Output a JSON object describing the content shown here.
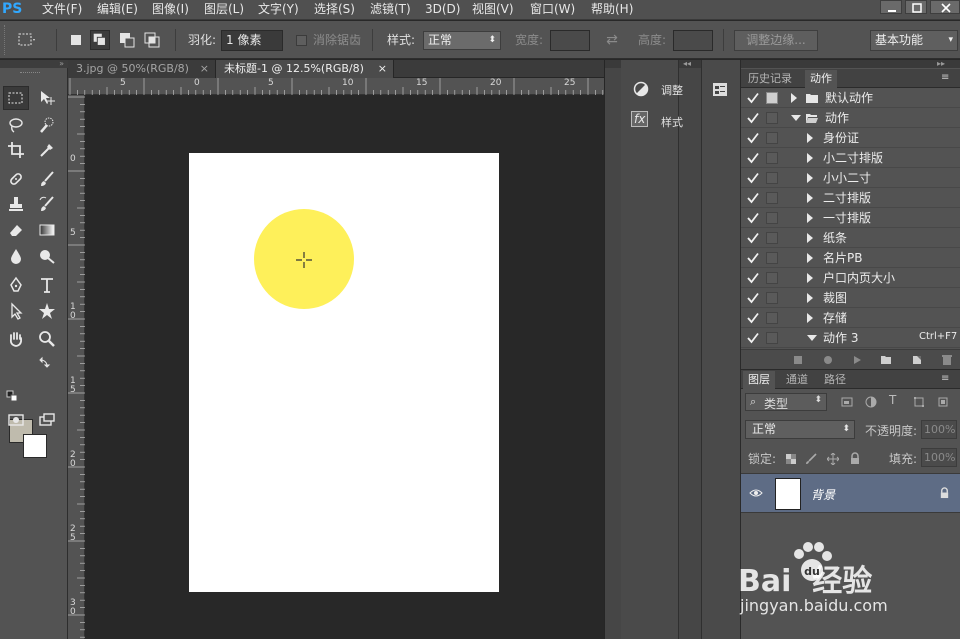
{
  "app": {
    "logo": "PS"
  },
  "menu": [
    "文件(F)",
    "编辑(E)",
    "图像(I)",
    "图层(L)",
    "文字(Y)",
    "选择(S)",
    "滤镜(T)",
    "3D(D)",
    "视图(V)",
    "窗口(W)",
    "帮助(H)"
  ],
  "options": {
    "feather_label": "羽化:",
    "feather_value": "1 像素",
    "antialias_label": "消除锯齿",
    "style_label": "样式:",
    "style_value": "正常",
    "width_label": "宽度:",
    "height_label": "高度:",
    "refine_edge": "调整边缘...",
    "workspace": "基本功能"
  },
  "tabs": [
    {
      "label": "3.jpg @ 50%(RGB/8)",
      "close": "×"
    },
    {
      "label": "未标题-1 @ 12.5%(RGB/8)",
      "close": "×"
    }
  ],
  "ruler": {
    "top_ticks": [
      "5",
      "0",
      "5",
      "10",
      "15",
      "20",
      "25"
    ],
    "left_ticks": [
      "0",
      "5",
      "1\n0",
      "1\n5",
      "2\n0",
      "2\n5",
      "3\n0"
    ]
  },
  "icon_panel": {
    "adjust_label": "调整",
    "styles_label": "样式"
  },
  "actions_panel": {
    "tab_history": "历史记录",
    "tab_actions": "动作",
    "rows": [
      {
        "label": "默认动作",
        "kind": "set",
        "expanded": false,
        "checked": true
      },
      {
        "label": "动作",
        "kind": "set",
        "expanded": true,
        "checked": true
      },
      {
        "label": "身份证",
        "kind": "action",
        "expanded": false,
        "checked": true
      },
      {
        "label": "小二寸排版",
        "kind": "action",
        "expanded": false,
        "checked": true
      },
      {
        "label": "小小二寸",
        "kind": "action",
        "expanded": false,
        "checked": true
      },
      {
        "label": "二寸排版",
        "kind": "action",
        "expanded": false,
        "checked": true
      },
      {
        "label": "一寸排版",
        "kind": "action",
        "expanded": false,
        "checked": true
      },
      {
        "label": "纸条",
        "kind": "action",
        "expanded": false,
        "checked": true
      },
      {
        "label": "名片PB",
        "kind": "action",
        "expanded": false,
        "checked": true
      },
      {
        "label": "户口内页大小",
        "kind": "action",
        "expanded": false,
        "checked": true
      },
      {
        "label": "裁图",
        "kind": "action",
        "expanded": false,
        "checked": true
      },
      {
        "label": "存储",
        "kind": "action",
        "expanded": false,
        "checked": true
      },
      {
        "label": "动作 3",
        "kind": "action",
        "expanded": true,
        "checked": true,
        "shortcut": "Ctrl+F7"
      }
    ]
  },
  "layers_panel": {
    "tab_layers": "图层",
    "tab_channels": "通道",
    "tab_paths": "路径",
    "filter_label": "类型",
    "blend_mode": "正常",
    "opacity_label": "不透明度:",
    "opacity_value": "100%",
    "lock_label": "锁定:",
    "fill_label": "填充:",
    "fill_value": "100%",
    "layer_name": "背景"
  },
  "watermark": {
    "brand_text": "Bai  经验",
    "url": "jingyan.baidu.com"
  },
  "colors": {
    "foreground": "#bfbbad",
    "background": "#ffffff",
    "circle": "#fef05a",
    "accent": "#31a8ff"
  }
}
